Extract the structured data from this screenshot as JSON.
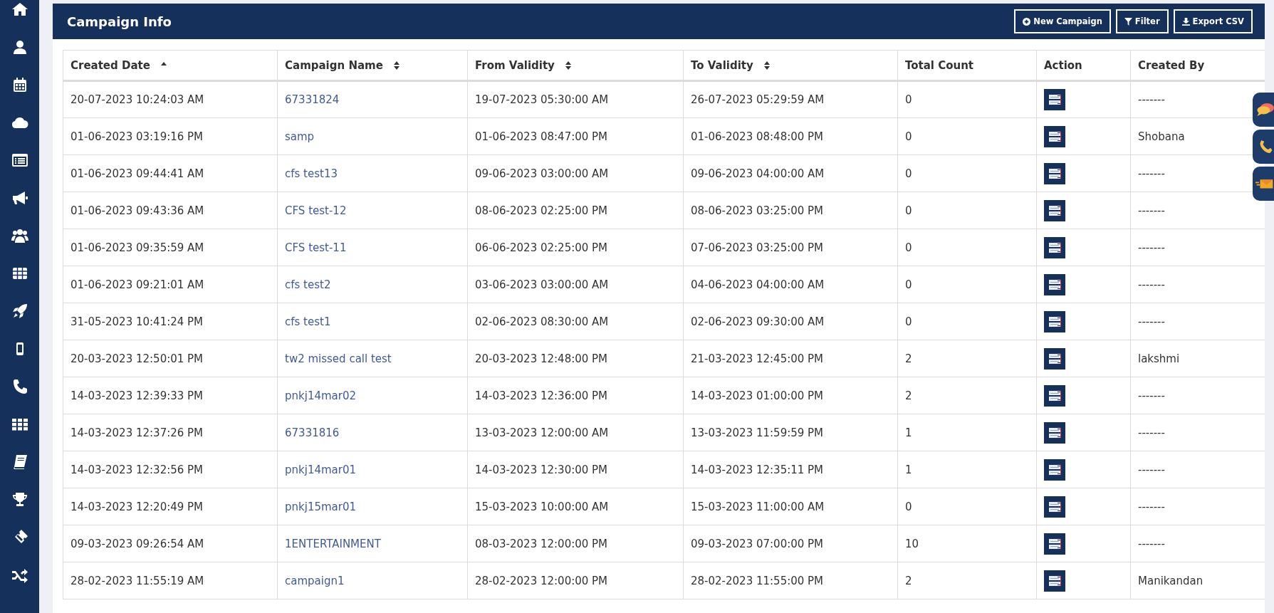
{
  "sidebar": {
    "items": [
      {
        "kind": "home"
      },
      {
        "kind": "user"
      },
      {
        "kind": "calendar"
      },
      {
        "kind": "cloud"
      },
      {
        "kind": "list"
      },
      {
        "kind": "megaphone"
      },
      {
        "kind": "users"
      },
      {
        "kind": "table"
      },
      {
        "kind": "rocket"
      },
      {
        "kind": "mobile"
      },
      {
        "kind": "phone"
      },
      {
        "kind": "grid"
      },
      {
        "kind": "book"
      },
      {
        "kind": "trophy"
      },
      {
        "kind": "ticket"
      },
      {
        "kind": "shuffle"
      }
    ]
  },
  "header": {
    "title": "Campaign Info",
    "buttons": [
      {
        "kind": "add",
        "label": "New Campaign"
      },
      {
        "kind": "filter",
        "label": "Filter"
      },
      {
        "kind": "download",
        "label": "Export CSV"
      }
    ]
  },
  "table": {
    "columns": [
      {
        "label": "Created Date",
        "sortable": true,
        "sorted_ascending": true
      },
      {
        "label": "Campaign Name",
        "sortable": true,
        "sorted_ascending": false
      },
      {
        "label": "From Validity",
        "sortable": true,
        "sorted_ascending": false
      },
      {
        "label": "To Validity",
        "sortable": true,
        "sorted_ascending": false
      },
      {
        "label": "Total Count",
        "sortable": false
      },
      {
        "label": "Action",
        "sortable": false
      },
      {
        "label": "Created By",
        "sortable": false
      }
    ],
    "rows": [
      {
        "created_date": "20-07-2023 10:24:03 AM",
        "campaign_name": "67331824",
        "from_validity": "19-07-2023 05:30:00 AM",
        "to_validity": "26-07-2023 05:29:59 AM",
        "total_count": "0",
        "created_by": "-------"
      },
      {
        "created_date": "01-06-2023 03:19:16 PM",
        "campaign_name": "samp",
        "from_validity": "01-06-2023 08:47:00 PM",
        "to_validity": "01-06-2023 08:48:00 PM",
        "total_count": "0",
        "created_by": "Shobana"
      },
      {
        "created_date": "01-06-2023 09:44:41 AM",
        "campaign_name": "cfs test13",
        "from_validity": "09-06-2023 03:00:00 AM",
        "to_validity": "09-06-2023 04:00:00 AM",
        "total_count": "0",
        "created_by": "-------"
      },
      {
        "created_date": "01-06-2023 09:43:36 AM",
        "campaign_name": "CFS test-12",
        "from_validity": "08-06-2023 02:25:00 PM",
        "to_validity": "08-06-2023 03:25:00 PM",
        "total_count": "0",
        "created_by": "-------"
      },
      {
        "created_date": "01-06-2023 09:35:59 AM",
        "campaign_name": "CFS test-11",
        "from_validity": "06-06-2023 02:25:00 PM",
        "to_validity": "07-06-2023 03:25:00 PM",
        "total_count": "0",
        "created_by": "-------"
      },
      {
        "created_date": "01-06-2023 09:21:01 AM",
        "campaign_name": "cfs test2",
        "from_validity": "03-06-2023 03:00:00 AM",
        "to_validity": "04-06-2023 04:00:00 AM",
        "total_count": "0",
        "created_by": "-------"
      },
      {
        "created_date": "31-05-2023 10:41:24 PM",
        "campaign_name": "cfs test1",
        "from_validity": "02-06-2023 08:30:00 AM",
        "to_validity": "02-06-2023 09:30:00 AM",
        "total_count": "0",
        "created_by": "-------"
      },
      {
        "created_date": "20-03-2023 12:50:01 PM",
        "campaign_name": "tw2 missed call test",
        "from_validity": "20-03-2023 12:48:00 PM",
        "to_validity": "21-03-2023 12:45:00 PM",
        "total_count": "2",
        "created_by": "lakshmi"
      },
      {
        "created_date": "14-03-2023 12:39:33 PM",
        "campaign_name": "pnkj14mar02",
        "from_validity": "14-03-2023 12:36:00 PM",
        "to_validity": "14-03-2023 01:00:00 PM",
        "total_count": "2",
        "created_by": "-------"
      },
      {
        "created_date": "14-03-2023 12:37:26 PM",
        "campaign_name": "67331816",
        "from_validity": "13-03-2023 12:00:00 AM",
        "to_validity": "13-03-2023 11:59:59 PM",
        "total_count": "1",
        "created_by": "-------"
      },
      {
        "created_date": "14-03-2023 12:32:56 PM",
        "campaign_name": "pnkj14mar01",
        "from_validity": "14-03-2023 12:30:00 PM",
        "to_validity": "14-03-2023 12:35:11 PM",
        "total_count": "1",
        "created_by": "-------"
      },
      {
        "created_date": "14-03-2023 12:20:49 PM",
        "campaign_name": "pnkj15mar01",
        "from_validity": "15-03-2023 10:00:00 AM",
        "to_validity": "15-03-2023 11:00:00 AM",
        "total_count": "0",
        "created_by": "-------"
      },
      {
        "created_date": "09-03-2023 09:26:54 AM",
        "campaign_name": "1ENTERTAINMENT",
        "from_validity": "08-03-2023 12:00:00 PM",
        "to_validity": "09-03-2023 07:00:00 PM",
        "total_count": "10",
        "created_by": "-------"
      },
      {
        "created_date": "28-02-2023 11:55:19 AM",
        "campaign_name": "campaign1",
        "from_validity": "28-02-2023 12:00:00 PM",
        "to_validity": "28-02-2023 11:55:00 PM",
        "total_count": "2",
        "created_by": "Manikandan"
      }
    ]
  },
  "floating_tabs": [
    {
      "kind": "chat"
    },
    {
      "kind": "phone"
    },
    {
      "kind": "mail"
    }
  ]
}
